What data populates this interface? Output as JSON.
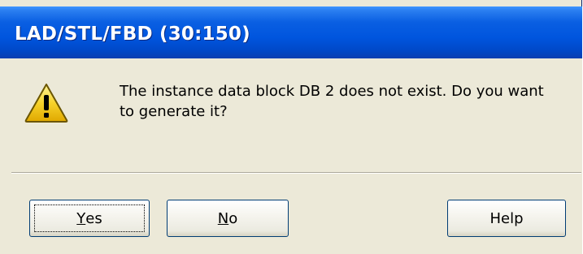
{
  "window": {
    "title": "LAD/STL/FBD  (30:150)"
  },
  "dialog": {
    "icon": "warning-icon",
    "message": "The instance data block DB 2 does not exist. Do you want to generate it?"
  },
  "buttons": {
    "yes": {
      "mnemonic": "Y",
      "rest": "es"
    },
    "no": {
      "mnemonic": "N",
      "rest": "o"
    },
    "help": {
      "label": "Help"
    }
  },
  "colors": {
    "titlebar": "#0055de",
    "dialog_background": "#ece9d8",
    "warning_yellow": "#f7d22a"
  }
}
